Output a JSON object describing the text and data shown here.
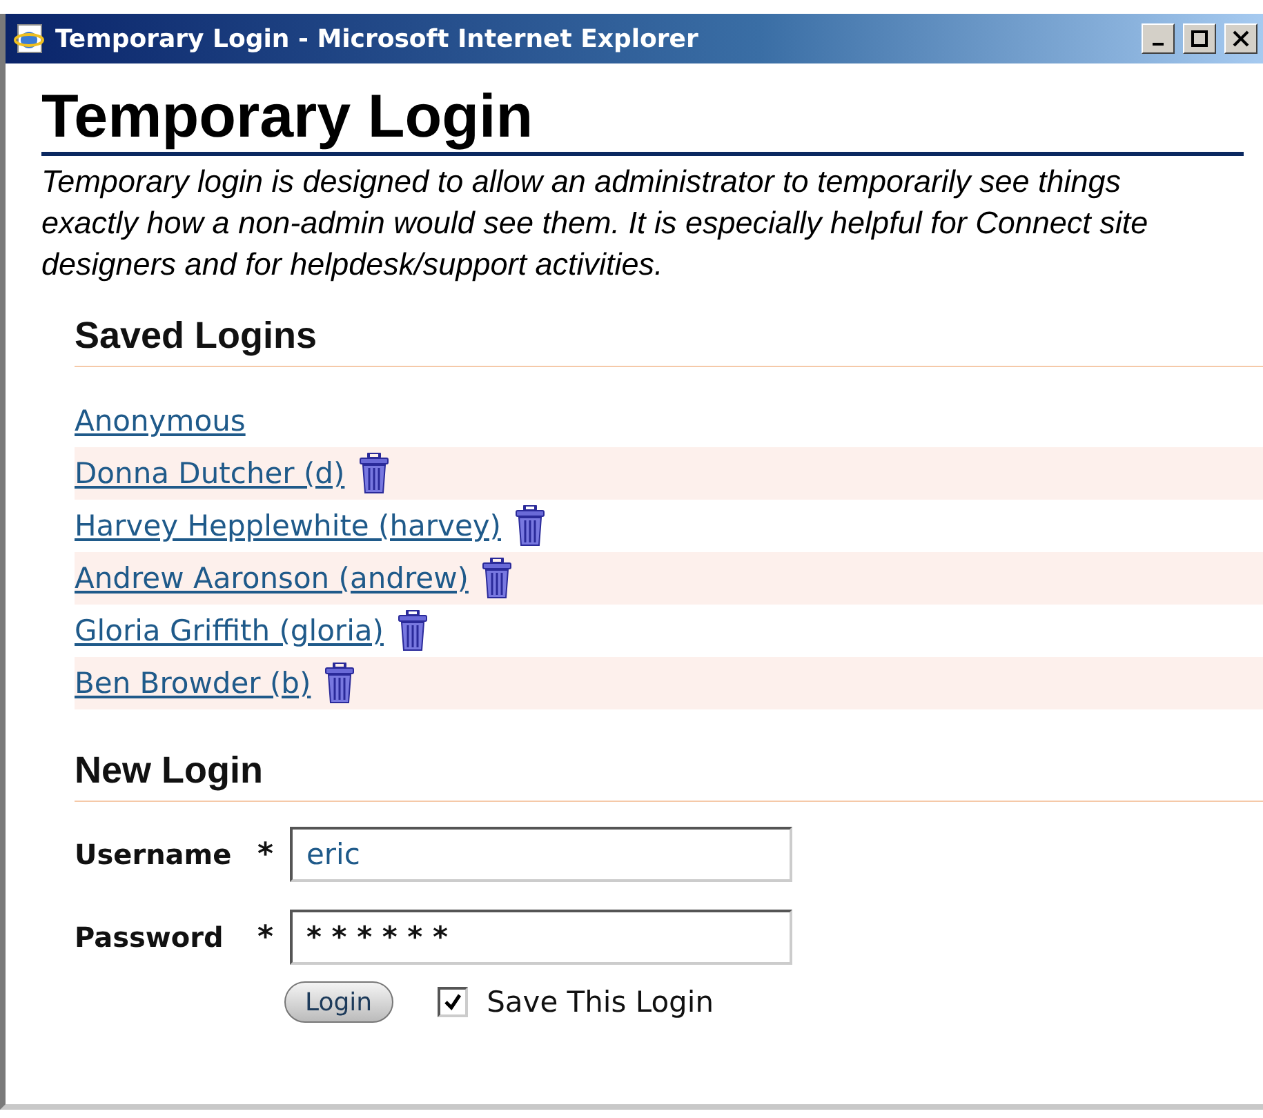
{
  "window": {
    "title": "Temporary Login - Microsoft Internet Explorer"
  },
  "page": {
    "heading": "Temporary Login",
    "intro": "Temporary login is designed to allow an administrator to temporarily see things exactly how a non-admin would see them. It is especially helpful for Connect site designers and for helpdesk/support activities."
  },
  "saved_logins": {
    "heading": "Saved Logins",
    "items": [
      {
        "label": "Anonymous",
        "deletable": false
      },
      {
        "label": "Donna Dutcher (d)",
        "deletable": true
      },
      {
        "label": "Harvey Hepplewhite (harvey)",
        "deletable": true
      },
      {
        "label": "Andrew Aaronson (andrew)",
        "deletable": true
      },
      {
        "label": "Gloria Griffith (gloria)",
        "deletable": true
      },
      {
        "label": "Ben Browder (b)",
        "deletable": true
      }
    ]
  },
  "new_login": {
    "heading": "New Login",
    "fields": [
      {
        "label": "Username",
        "required_mark": "*",
        "value": "eric",
        "kind": "text"
      },
      {
        "label": "Password",
        "required_mark": "*",
        "value": "* * * * * *",
        "kind": "password"
      }
    ],
    "button": "Login",
    "save_checkbox": {
      "label": "Save This Login",
      "checked": true
    }
  }
}
